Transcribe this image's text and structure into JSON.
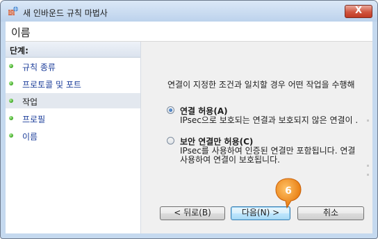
{
  "window": {
    "title": "새 인바운드 규칙 마법사",
    "close_label": "X"
  },
  "header": {
    "title": "이름"
  },
  "sidebar": {
    "heading": "단계:",
    "steps": [
      {
        "label": "규칙 종류"
      },
      {
        "label": "프로토콜 및 포트"
      },
      {
        "label": "작업"
      },
      {
        "label": "프로필"
      },
      {
        "label": "이름"
      }
    ],
    "current_step": 2
  },
  "main": {
    "description": "연결이 지정한 조건과 일치할 경우 어떤 작업을 수행해",
    "options": [
      {
        "title": "연결 허용(A)",
        "description": [
          "IPsec으로 보호되는 연결과 보호되지 않은 연결이 ."
        ],
        "selected": true
      },
      {
        "title": "보안 연결만 허용(C)",
        "description": [
          "IPsec를 사용하여 인증된 연결만 포함됩니다. 연결",
          "사용하여 연결이 보호됩니다."
        ],
        "selected": false
      }
    ]
  },
  "buttons": {
    "back": "< 뒤로(B)",
    "next": "다음(N) >",
    "cancel": "취소"
  },
  "annotation": {
    "number": "6",
    "color": "#f08a0c"
  }
}
